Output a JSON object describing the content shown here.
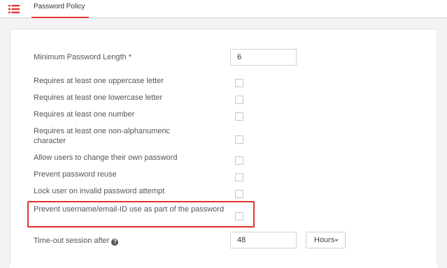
{
  "header": {
    "tab_label": "Password Policy",
    "accent_color": "#e53935",
    "menu_icon": "list-icon"
  },
  "form": {
    "min_length": {
      "label": "Minimum Password Length",
      "required_mark": " *",
      "value": "6"
    },
    "checkbox_options": [
      {
        "label": "Requires at least one uppercase letter",
        "checked": false
      },
      {
        "label": "Requires at least one lowercase letter",
        "checked": false
      },
      {
        "label": "Requires at least one number",
        "checked": false
      },
      {
        "label": "Requires at least one non-alphanumeric character",
        "checked": false
      },
      {
        "label": "Allow users to change their own password",
        "checked": false
      },
      {
        "label": "Prevent password reuse",
        "checked": false
      },
      {
        "label": "Lock user on invalid password attempt",
        "checked": false
      },
      {
        "label": "Prevent username/email-ID use as part of the password",
        "checked": false
      }
    ],
    "timeout": {
      "label": "Time-out session after",
      "help_icon": "question-circle-icon",
      "value": "48",
      "unit": "Hours"
    }
  },
  "highlight_color": "#e0322b"
}
